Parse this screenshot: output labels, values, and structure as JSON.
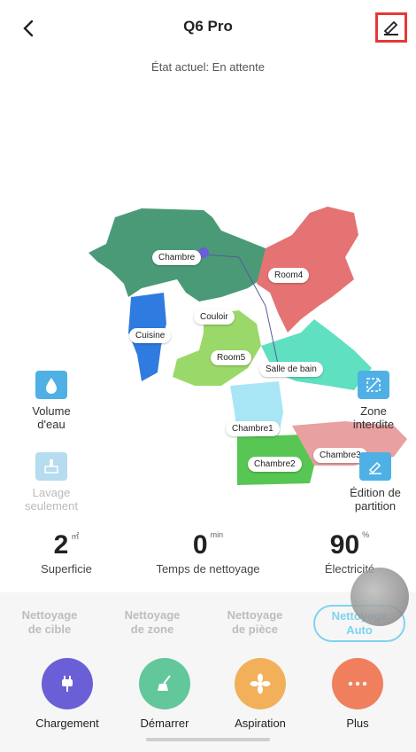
{
  "header": {
    "title": "Q6 Pro",
    "status": "État actuel: En attente"
  },
  "map": {
    "rooms": [
      "Chambre",
      "Room4",
      "Couloir",
      "Cuisine",
      "Room5",
      "Salle de bain",
      "Chambre1",
      "Chambre2",
      "Chambre3"
    ],
    "colors": {
      "green_dark": "#4a9a78",
      "red": "#e57373",
      "blue": "#2f7be0",
      "lime": "#9bd86a",
      "cyan": "#5fe0c0",
      "light_blue": "#a8e6f5",
      "green": "#57c653",
      "pink": "#e8a0a0"
    }
  },
  "side_controls": {
    "water_volume": "Volume\nd'eau",
    "mop_only": "Lavage\nseulement",
    "no_go_zone": "Zone\ninterdite",
    "edit_partition": "Édition de\npartition"
  },
  "stats": [
    {
      "value": "2",
      "unit": "㎡",
      "label": "Superficie"
    },
    {
      "value": "0",
      "unit": "min",
      "label": "Temps de nettoyage"
    },
    {
      "value": "90",
      "unit": "%",
      "label": "Électricité"
    }
  ],
  "modes": [
    {
      "line1": "Nettoyage",
      "line2": "de cible"
    },
    {
      "line1": "Nettoyage",
      "line2": "de zone"
    },
    {
      "line1": "Nettoyage",
      "line2": "de pièce"
    },
    {
      "line1": "Nettoyage",
      "line2": "Auto"
    }
  ],
  "actions": [
    {
      "label": "Chargement",
      "color": "#6a5fd6",
      "icon": "plug-icon"
    },
    {
      "label": "Démarrer",
      "color": "#62c79a",
      "icon": "broom-icon"
    },
    {
      "label": "Aspiration",
      "color": "#f2b05a",
      "icon": "fan-icon"
    },
    {
      "label": "Plus",
      "color": "#f07f5e",
      "icon": "more-icon"
    }
  ],
  "accent": "#7fd3f0",
  "highlight": "#e53935"
}
